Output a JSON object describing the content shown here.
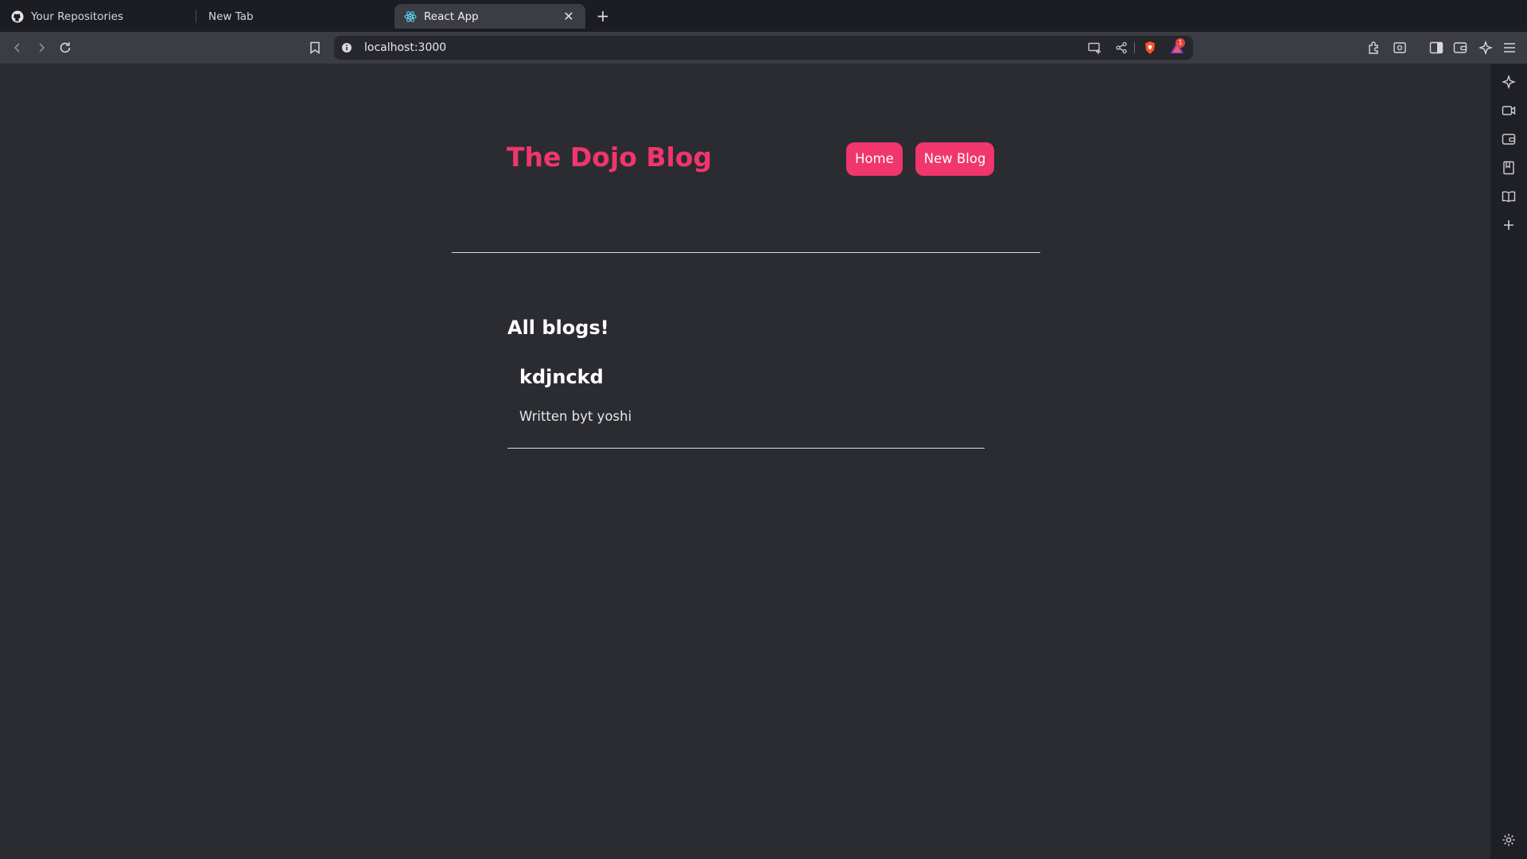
{
  "browser": {
    "tabs": [
      {
        "label": "Your Repositories",
        "icon": "github-icon",
        "active": false
      },
      {
        "label": "New Tab",
        "icon": "",
        "active": false
      },
      {
        "label": "React App",
        "icon": "react-icon",
        "active": true
      }
    ],
    "address": "localhost:3000",
    "notification_count": "1"
  },
  "site": {
    "brand": "The Dojo Blog",
    "nav": [
      {
        "label": "Home"
      },
      {
        "label": "New Blog"
      }
    ],
    "heading": "All blogs!",
    "blogs": [
      {
        "title": "kdjnckd",
        "author_line": "Written byt yoshi"
      }
    ]
  },
  "colors": {
    "accent": "#f1356d",
    "page_bg": "#2a2c31",
    "chrome_bg": "#1c1d22",
    "toolbar_bg": "#3b3c44"
  }
}
